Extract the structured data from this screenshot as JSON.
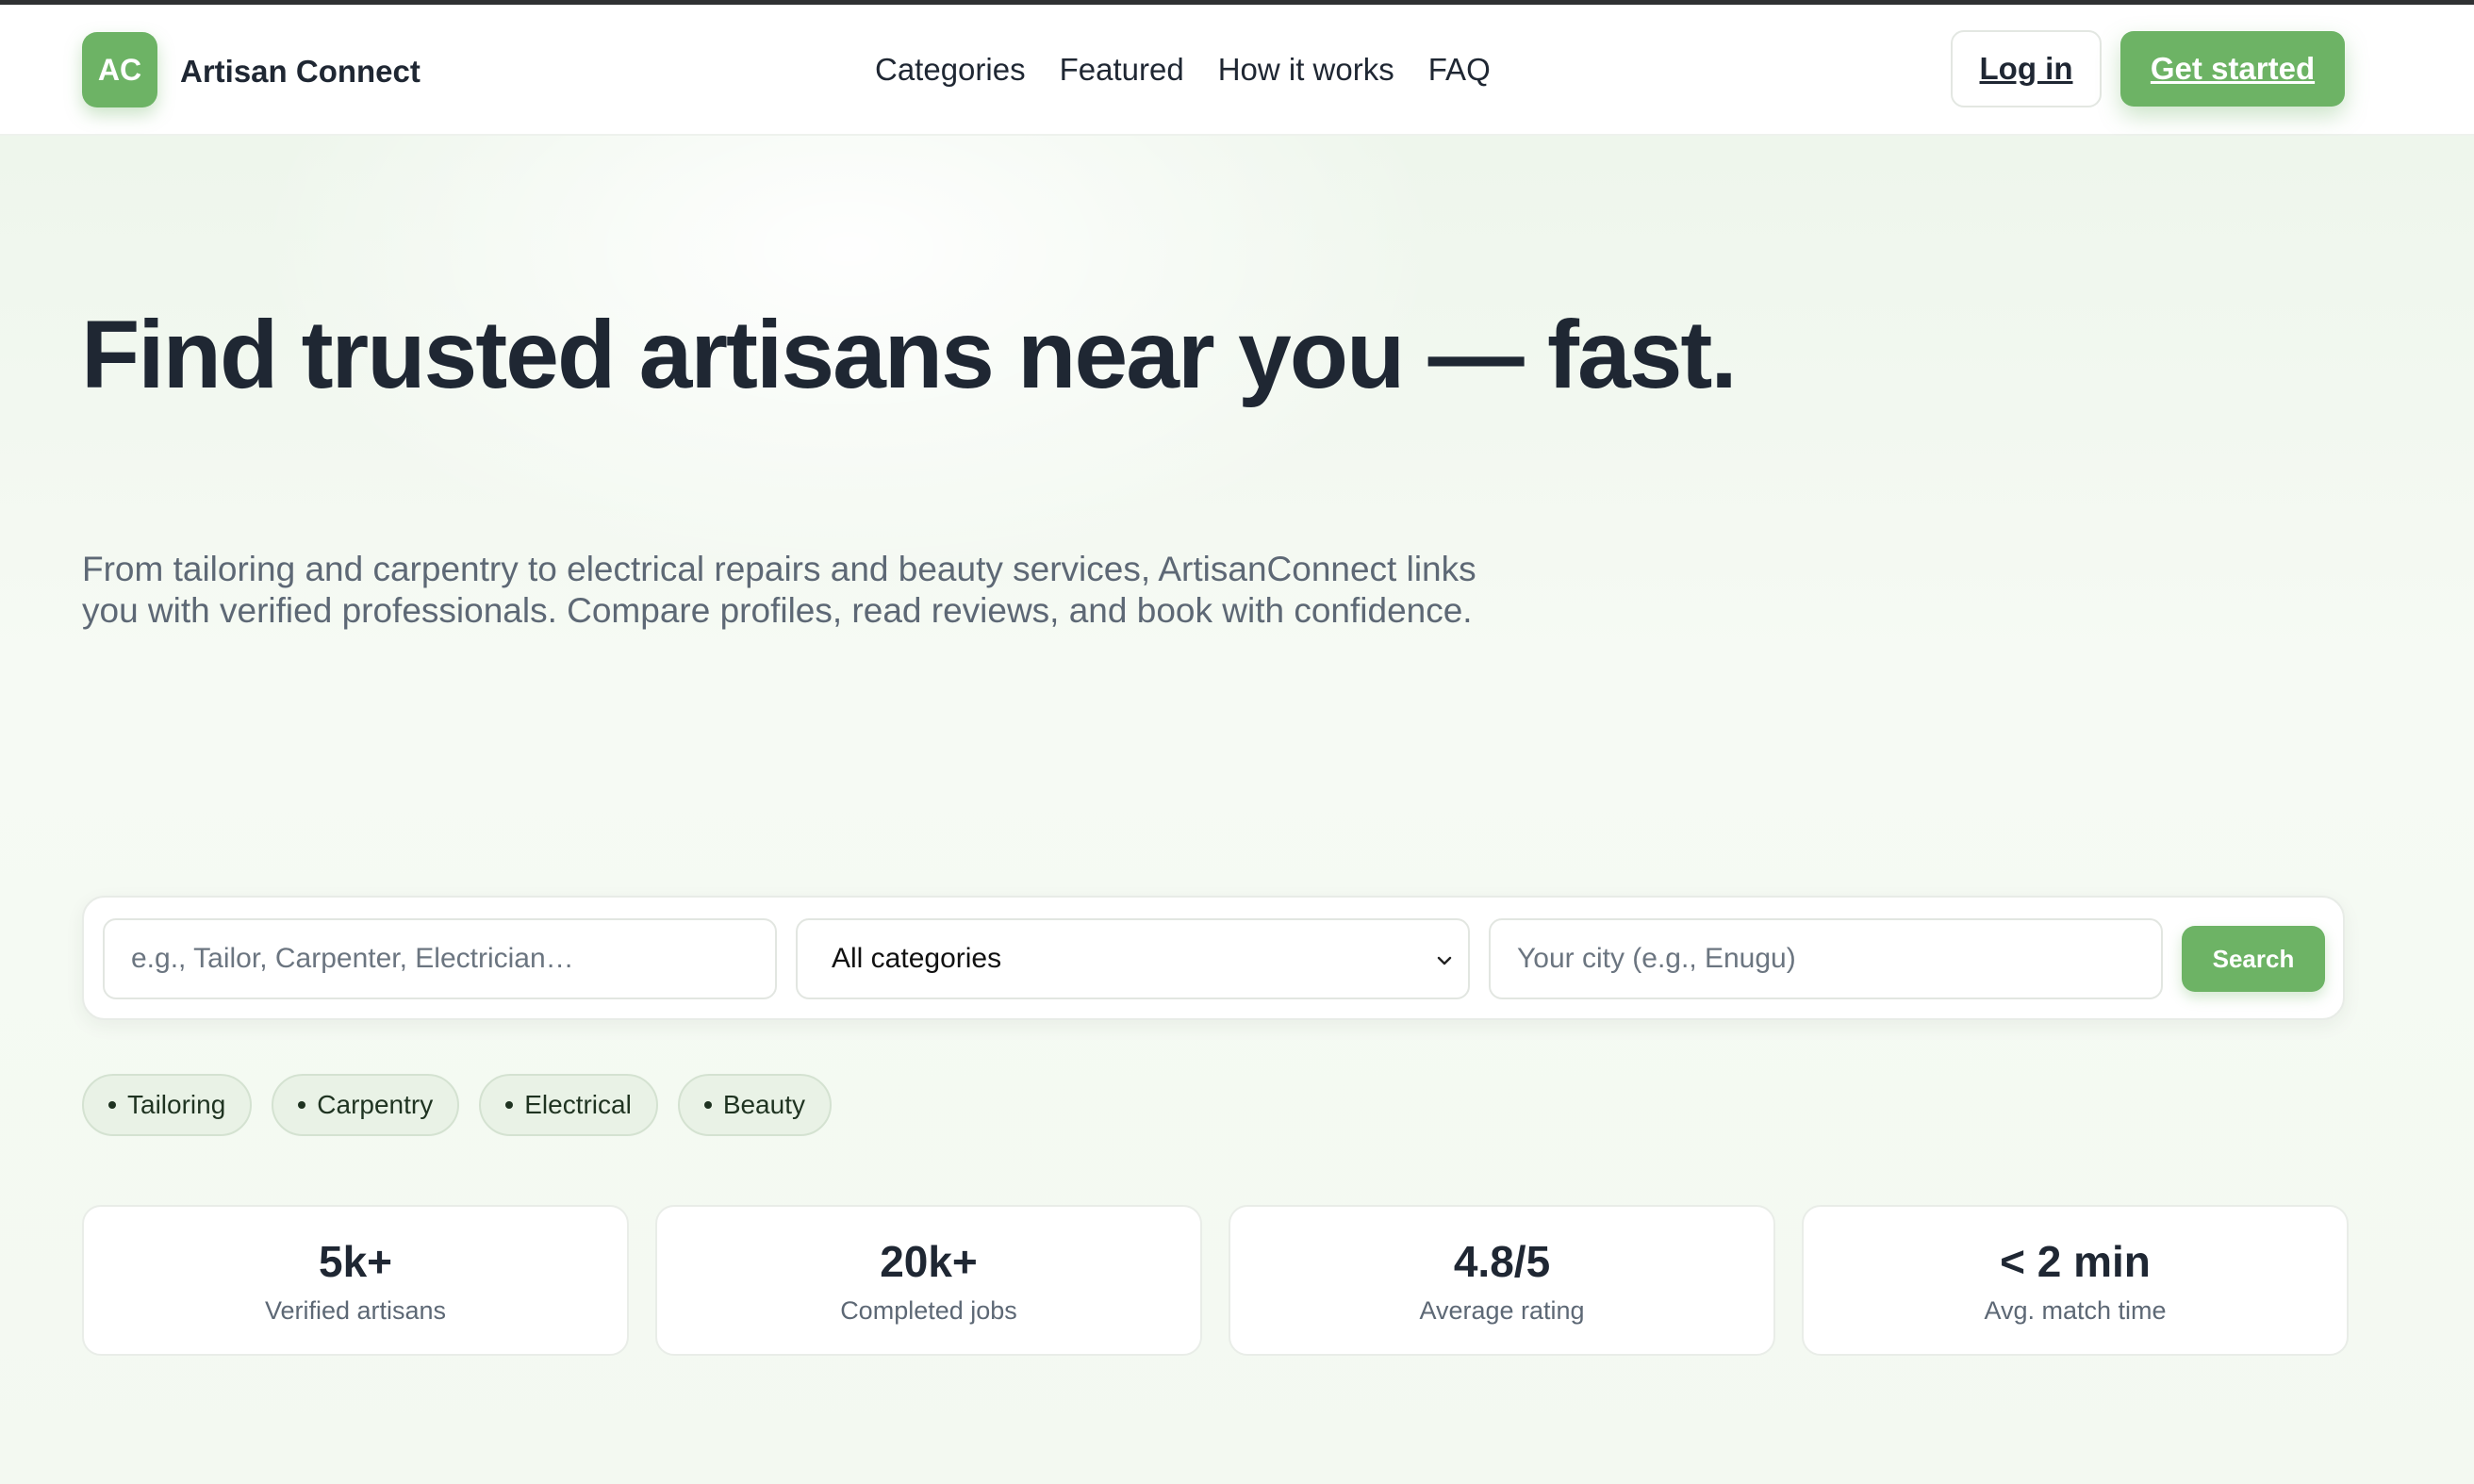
{
  "header": {
    "logo_initials": "AC",
    "brand": "Artisan Connect",
    "nav": [
      "Categories",
      "Featured",
      "How it works",
      "FAQ"
    ],
    "login_label": "Log in",
    "cta_label": "Get started"
  },
  "hero": {
    "headline": "Find trusted artisans near you — fast.",
    "subtext": "From tailoring and carpentry to electrical repairs and beauty services, ArtisanConnect links you with verified professionals. Compare profiles, read reviews, and book with confidence."
  },
  "search": {
    "query_placeholder": "e.g., Tailor, Carpenter, Electrician…",
    "category_value": "All categories",
    "city_placeholder": "Your city (e.g., Enugu)",
    "button_label": "Search"
  },
  "chips": [
    "Tailoring",
    "Carpentry",
    "Electrical",
    "Beauty"
  ],
  "stats": [
    {
      "value": "5k+",
      "label": "Verified artisans"
    },
    {
      "value": "20k+",
      "label": "Completed jobs"
    },
    {
      "value": "4.8/5",
      "label": "Average rating"
    },
    {
      "value": "< 2 min",
      "label": "Avg. match time"
    }
  ],
  "colors": {
    "accent": "#6db365",
    "text": "#1f2733",
    "muted": "#5d6875"
  },
  "icons": {
    "category_select": "chevron-down-icon"
  }
}
